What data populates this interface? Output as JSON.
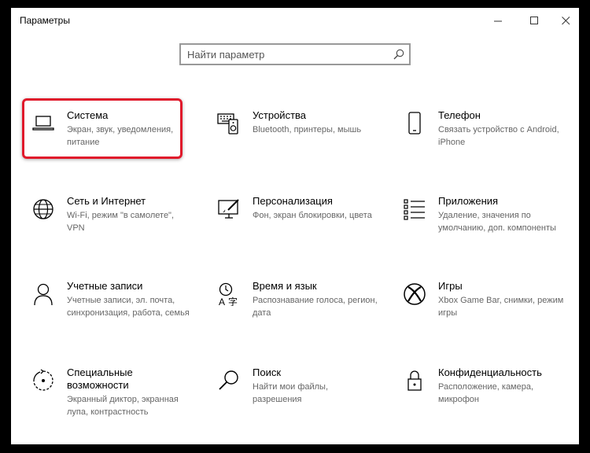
{
  "window": {
    "title": "Параметры",
    "controls": [
      "minimize",
      "maximize",
      "close"
    ]
  },
  "search": {
    "placeholder": "Найти параметр",
    "value": ""
  },
  "accent_color": "#005a9e",
  "highlight_color": "#e0192b",
  "tiles": [
    {
      "title": "Система",
      "description": "Экран, звук, уведомления, питание",
      "icon": "laptop-icon"
    },
    {
      "title": "Устройства",
      "description": "Bluetooth, принтеры, мышь",
      "icon": "devices-icon"
    },
    {
      "title": "Телефон",
      "description": "Связать устройство с Android, iPhone",
      "icon": "phone-icon"
    },
    {
      "title": "Сеть и Интернет",
      "description": "Wi-Fi, режим \"в самолете\", VPN",
      "icon": "globe-icon"
    },
    {
      "title": "Персонализация",
      "description": "Фон, экран блокировки, цвета",
      "icon": "personalization-icon"
    },
    {
      "title": "Приложения",
      "description": "Удаление, значения по умолчанию, доп. компоненты",
      "icon": "apps-list-icon"
    },
    {
      "title": "Учетные записи",
      "description": "Учетные записи, эл. почта, синхронизация, работа, семья",
      "icon": "person-icon"
    },
    {
      "title": "Время и язык",
      "description": "Распознавание голоса, регион, дата",
      "icon": "time-language-icon"
    },
    {
      "title": "Игры",
      "description": "Xbox Game Bar, снимки, режим игры",
      "icon": "xbox-icon"
    },
    {
      "title": "Специальные возможности",
      "description": "Экранный диктор, экранная лупа, контрастность",
      "icon": "accessibility-icon"
    },
    {
      "title": "Поиск",
      "description": "Найти мои файлы, разрешения",
      "icon": "search-magnifier-icon"
    },
    {
      "title": "Конфиденциальность",
      "description": "Расположение, камера, микрофон",
      "icon": "lock-icon"
    }
  ]
}
